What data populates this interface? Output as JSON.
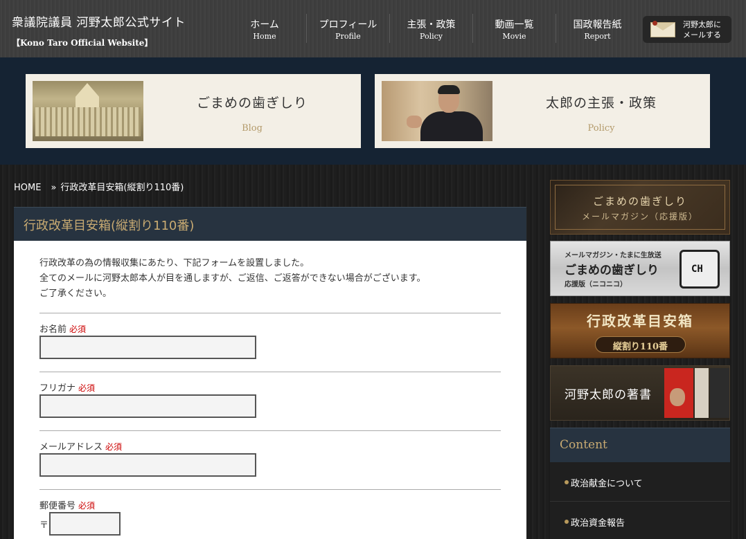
{
  "header": {
    "site_title": "衆議院議員 河野太郎公式サイト",
    "site_subtitle": "【Kono Taro Official Website】",
    "nav": [
      {
        "jp": "ホーム",
        "en": "Home"
      },
      {
        "jp": "プロフィール",
        "en": "Profile"
      },
      {
        "jp": "主張・政策",
        "en": "Policy"
      },
      {
        "jp": "動画一覧",
        "en": "Movie"
      },
      {
        "jp": "国政報告紙",
        "en": "Report"
      }
    ],
    "mail_button": {
      "line1": "河野太郎に",
      "line2": "メールする",
      "icon": "envelope-icon"
    }
  },
  "banner": {
    "cards": [
      {
        "title": "ごまめの歯ぎしり",
        "subtitle": "Blog"
      },
      {
        "title": "太郎の主張・政策",
        "subtitle": "Policy"
      }
    ]
  },
  "breadcrumb": {
    "home": "HOME",
    "separator": "»",
    "current": "行政改革目安箱(縦割り110番)"
  },
  "main": {
    "title": "行政改革目安箱(縦割り110番)",
    "intro": [
      "行政改革の為の情報収集にあたり、下記フォームを設置しました。",
      "全てのメールに河野太郎本人が目を通しますが、ご返信、ご返答ができない場合がございます。",
      "ご了承ください。"
    ],
    "form": {
      "required_mark": "必須",
      "fields": [
        {
          "label": "お名前",
          "value": ""
        },
        {
          "label": "フリガナ",
          "value": ""
        },
        {
          "label": "メールアドレス",
          "value": ""
        },
        {
          "label": "郵便番号",
          "prefix": "〒",
          "value": ""
        }
      ]
    }
  },
  "sidebar": {
    "banner1": {
      "line1": "ごまめの歯ぎしり",
      "line2": "メールマガジン（応援版）"
    },
    "banner2": {
      "top": "メールマガジン・たまに生放送",
      "title": "ごまめの歯ぎしり",
      "bottom": "応援版（ニコニコ）",
      "logo": "CH"
    },
    "banner3": {
      "title": "行政改革目安箱",
      "subtitle": "縦割り110番"
    },
    "banner4": {
      "title": "河野太郎の著書"
    },
    "content": {
      "title": "Content",
      "items": [
        "政治献金について",
        "政治資金報告"
      ]
    }
  },
  "colors": {
    "header_bg": "#3e3e3e",
    "banner_bg": "#152333",
    "panel_head": "#273340",
    "accent_gold": "#c9ab72",
    "required_red": "#cc0000"
  }
}
